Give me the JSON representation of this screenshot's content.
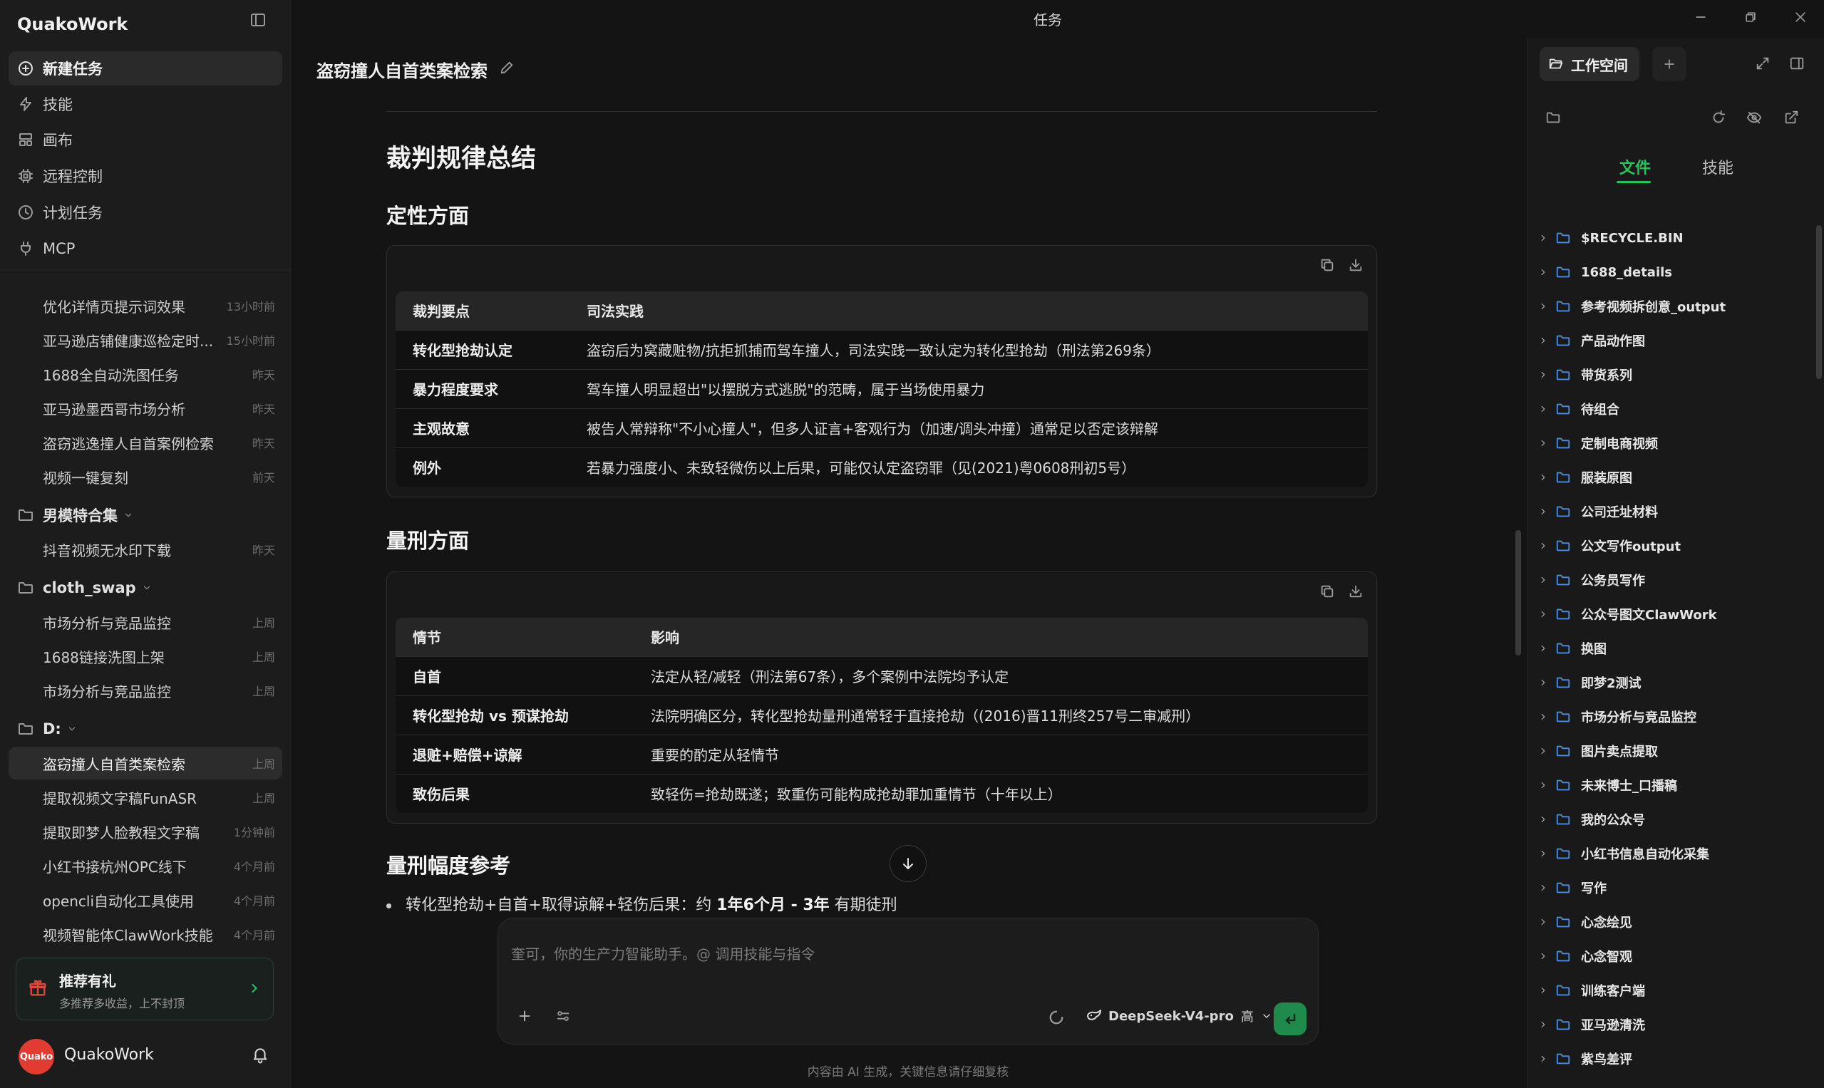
{
  "app": {
    "name": "QuakoWork",
    "window_title": "任务"
  },
  "nav": [
    {
      "label": "新建任务",
      "icon": "plus-circle-icon"
    },
    {
      "label": "技能",
      "icon": "lightning-icon"
    },
    {
      "label": "画布",
      "icon": "layout-icon"
    },
    {
      "label": "远程控制",
      "icon": "chip-icon"
    },
    {
      "label": "计划任务",
      "icon": "clock-icon"
    },
    {
      "label": "MCP",
      "icon": "plug-icon"
    }
  ],
  "history": [
    {
      "title": "优化详情页提示词效果",
      "time": "13小时前"
    },
    {
      "title": "亚马逊店铺健康巡检定时...",
      "time": "15小时前"
    },
    {
      "title": "1688全自动洗图任务",
      "time": "昨天"
    },
    {
      "title": "亚马逊墨西哥市场分析",
      "time": "昨天"
    },
    {
      "title": "盗窃逃逸撞人自首案例检索",
      "time": "昨天"
    },
    {
      "title": "视频一键复刻",
      "time": "前天"
    }
  ],
  "folders": [
    {
      "name": "男模特合集",
      "items": [
        {
          "title": "抖音视频无水印下载",
          "time": "昨天"
        }
      ]
    },
    {
      "name": "cloth_swap",
      "items": [
        {
          "title": "市场分析与竞品监控",
          "time": "上周"
        },
        {
          "title": "1688链接洗图上架",
          "time": "上周"
        },
        {
          "title": "市场分析与竞品监控",
          "time": "上周"
        }
      ]
    },
    {
      "name": "D:",
      "items": [
        {
          "title": "盗窃撞人自首类案检索",
          "time": "上周"
        },
        {
          "title": "提取视频文字稿FunASR",
          "time": "上周"
        },
        {
          "title": "提取即梦人脸教程文字稿",
          "time": "1分钟前"
        },
        {
          "title": "小红书接杭州OPC线下",
          "time": "4个月前"
        },
        {
          "title": "opencli自动化工具使用",
          "time": "4个月前"
        },
        {
          "title": "视频智能体ClawWork技能",
          "time": "4个月前"
        }
      ]
    }
  ],
  "promo": {
    "title": "推荐有礼",
    "subtitle": "多推荐多收益，上不封顶"
  },
  "user": {
    "name": "QuakoWork",
    "avatar_text": "Quako"
  },
  "task": {
    "title": "盗窃撞人自首类案检索"
  },
  "content": {
    "h1": "裁判规律总结",
    "section1": {
      "heading": "定性方面",
      "columns": [
        "裁判要点",
        "司法实践"
      ],
      "rows": [
        [
          "转化型抢劫认定",
          "盗窃后为窝藏赃物/抗拒抓捕而驾车撞人，司法实践一致认定为转化型抢劫（刑法第269条）"
        ],
        [
          "暴力程度要求",
          "驾车撞人明显超出\"以摆脱方式逃脱\"的范畴，属于当场使用暴力"
        ],
        [
          "主观故意",
          "被告人常辩称\"不小心撞人\"，但多人证言+客观行为（加速/调头冲撞）通常足以否定该辩解"
        ],
        [
          "例外",
          "若暴力强度小、未致轻微伤以上后果，可能仅认定盗窃罪（见(2021)粤0608刑初5号）"
        ]
      ]
    },
    "section2": {
      "heading": "量刑方面",
      "columns": [
        "情节",
        "影响"
      ],
      "rows": [
        [
          "自首",
          "法定从轻/减轻（刑法第67条），多个案例中法院均予认定"
        ],
        [
          "转化型抢劫 vs 预谋抢劫",
          "法院明确区分，转化型抢劫量刑通常轻于直接抢劫（(2016)晋11刑终257号二审减刑）"
        ],
        [
          "退赃+赔偿+谅解",
          "重要的酌定从轻情节"
        ],
        [
          "致伤后果",
          "致轻伤=抢劫既遂；致重伤可能构成抢劫罪加重情节（十年以上）"
        ]
      ]
    },
    "section3": {
      "heading": "量刑幅度参考",
      "bullet_prefix": "转化型抢劫+自首+取得谅解+轻伤后果：约 ",
      "bullet_bold": "1年6个月 - 3年",
      "bullet_suffix": " 有期徒刑"
    }
  },
  "composer": {
    "placeholder": "奎可，你的生产力智能助手。@ 调用技能与指令",
    "model": "DeepSeek-V4-pro",
    "quality": "高"
  },
  "disclaimer": "内容由 AI 生成，关键信息请仔细复核",
  "workspace": {
    "button_label": "工作空间",
    "tabs": [
      "文件",
      "技能"
    ],
    "files": [
      "$RECYCLE.BIN",
      "1688_details",
      "参考视频拆创意_output",
      "产品动作图",
      "带货系列",
      "待组合",
      "定制电商视频",
      "服装原图",
      "公司迁址材料",
      "公文写作output",
      "公务员写作",
      "公众号图文ClawWork",
      "换图",
      "即梦2测试",
      "市场分析与竞品监控",
      "图片卖点提取",
      "未来博士_口播稿",
      "我的公众号",
      "小红书信息自动化采集",
      "写作",
      "心念绘见",
      "心念智观",
      "训练客户端",
      "亚马逊清洗",
      "紫鸟差评"
    ]
  },
  "colors": {
    "accent": "#22c55e",
    "send_button": "#1e8a4c",
    "avatar": "#e23b32"
  }
}
